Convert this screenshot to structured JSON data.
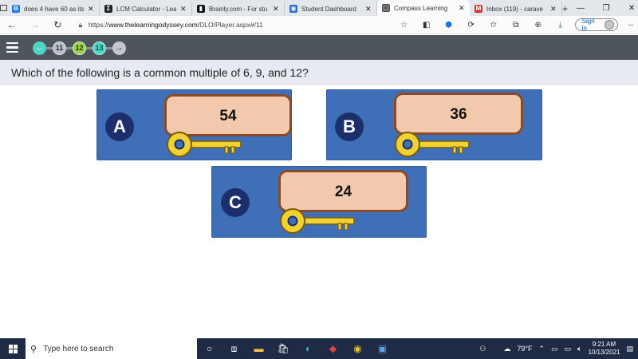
{
  "browser": {
    "tabs": [
      {
        "label": "does 4 have 60 as its",
        "favicon": "B",
        "favicon_color": "#1877f2",
        "active": false
      },
      {
        "label": "LCM Calculator - Lea",
        "favicon": "Σ",
        "favicon_color": "#222222",
        "active": false
      },
      {
        "label": "Brainly.com - For stu",
        "favicon": "▮",
        "favicon_color": "#111111",
        "active": false
      },
      {
        "label": "Student Dashboard",
        "favicon": "◉",
        "favicon_color": "#2a6fd6",
        "active": false
      },
      {
        "label": "Compass Learning",
        "favicon": "▢",
        "favicon_color": "#555555",
        "active": true
      },
      {
        "label": "Inbox (119) - carave",
        "favicon": "M",
        "favicon_color": "#d93025",
        "active": false
      }
    ],
    "url_prefix": "https://",
    "url_host": "www.thelearningodyssey.com",
    "url_path": "/DLO/Player.aspx#/11",
    "signin_label": "Sign in"
  },
  "player": {
    "pager": {
      "previous": "11",
      "current": "12",
      "next": "13"
    },
    "question": "Which of the following is a common multiple of 6, 9, and 12?",
    "answers": [
      {
        "letter": "A",
        "value": "54"
      },
      {
        "letter": "B",
        "value": "36"
      },
      {
        "letter": "C",
        "value": "24"
      }
    ]
  },
  "taskbar": {
    "search_placeholder": "Type here to search",
    "temperature": "79°F",
    "time": "9:21 AM",
    "date": "10/13/2021"
  },
  "colors": {
    "card_blue": "#3f6fb7",
    "letter_circle": "#1c2e6b",
    "plate_fill": "#f3c9ad",
    "plate_border": "#8a4a2a",
    "key_gold": "#f2d230",
    "player_header": "#4f555c",
    "question_band": "#e7ebf1"
  }
}
